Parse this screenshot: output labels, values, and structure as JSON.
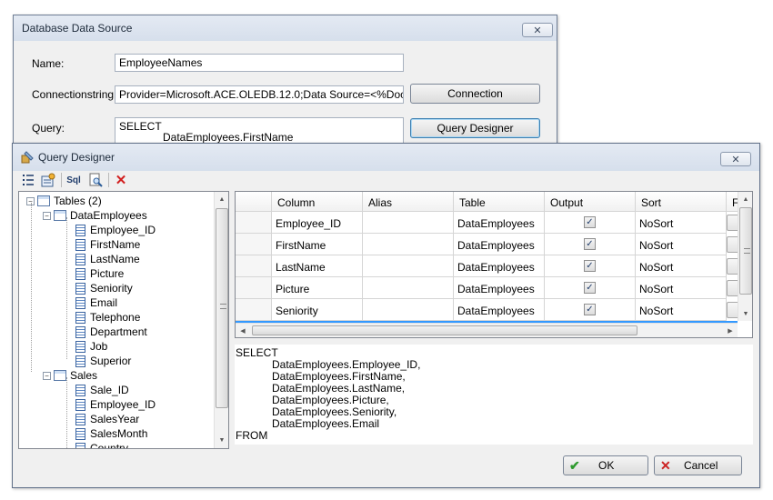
{
  "datasource": {
    "title": "Database Data Source",
    "close_glyph": "✕",
    "name_label": "Name:",
    "name_value": "EmployeeNames",
    "conn_label": "Connectionstring:",
    "conn_value": "Provider=Microsoft.ACE.OLEDB.12.0;Data Source=<%DocPath%>",
    "connection_button": "Connection",
    "query_label": "Query:",
    "query_line1": "SELECT",
    "query_line2": "DataEmployees.FirstName",
    "query_designer_button": "Query Designer"
  },
  "designer": {
    "title": "Query Designer",
    "close_glyph": "✕",
    "toolbar_icons": [
      "add-table-icon",
      "properties-icon",
      "sql-icon",
      "preview-icon",
      "delete-icon"
    ],
    "toolbar_sql_text": "Sql",
    "toolbar_delete_glyph": "✕",
    "tree": {
      "root": "Tables (2)",
      "tables": [
        {
          "name": "DataEmployees",
          "columns": [
            "Employee_ID",
            "FirstName",
            "LastName",
            "Picture",
            "Seniority",
            "Email",
            "Telephone",
            "Department",
            "Job",
            "Superior"
          ]
        },
        {
          "name": "Sales",
          "columns": [
            "Sale_ID",
            "Employee_ID",
            "SalesYear",
            "SalesMonth",
            "Country"
          ]
        }
      ]
    },
    "grid": {
      "headers": [
        "Column",
        "Alias",
        "Table",
        "Output",
        "Sort",
        "F"
      ],
      "rows": [
        {
          "column": "Employee_ID",
          "alias": "",
          "table": "DataEmployees",
          "output": "✓",
          "sort": "NoSort"
        },
        {
          "column": "FirstName",
          "alias": "",
          "table": "DataEmployees",
          "output": "✓",
          "sort": "NoSort"
        },
        {
          "column": "LastName",
          "alias": "",
          "table": "DataEmployees",
          "output": "✓",
          "sort": "NoSort"
        },
        {
          "column": "Picture",
          "alias": "",
          "table": "DataEmployees",
          "output": "✓",
          "sort": "NoSort"
        },
        {
          "column": "Seniority",
          "alias": "",
          "table": "DataEmployees",
          "output": "✓",
          "sort": "NoSort"
        }
      ]
    },
    "sql_text": "SELECT\n            DataEmployees.Employee_ID,\n            DataEmployees.FirstName,\n            DataEmployees.LastName,\n            DataEmployees.Picture,\n            DataEmployees.Seniority,\n            DataEmployees.Email\nFROM",
    "ok_button": "OK",
    "cancel_button": "Cancel",
    "ok_glyph": "✔",
    "cancel_glyph": "✕"
  },
  "colors": {
    "ok_green": "#2e9a2e",
    "cancel_red": "#cc2222",
    "selection_blue": "#3399ff"
  }
}
